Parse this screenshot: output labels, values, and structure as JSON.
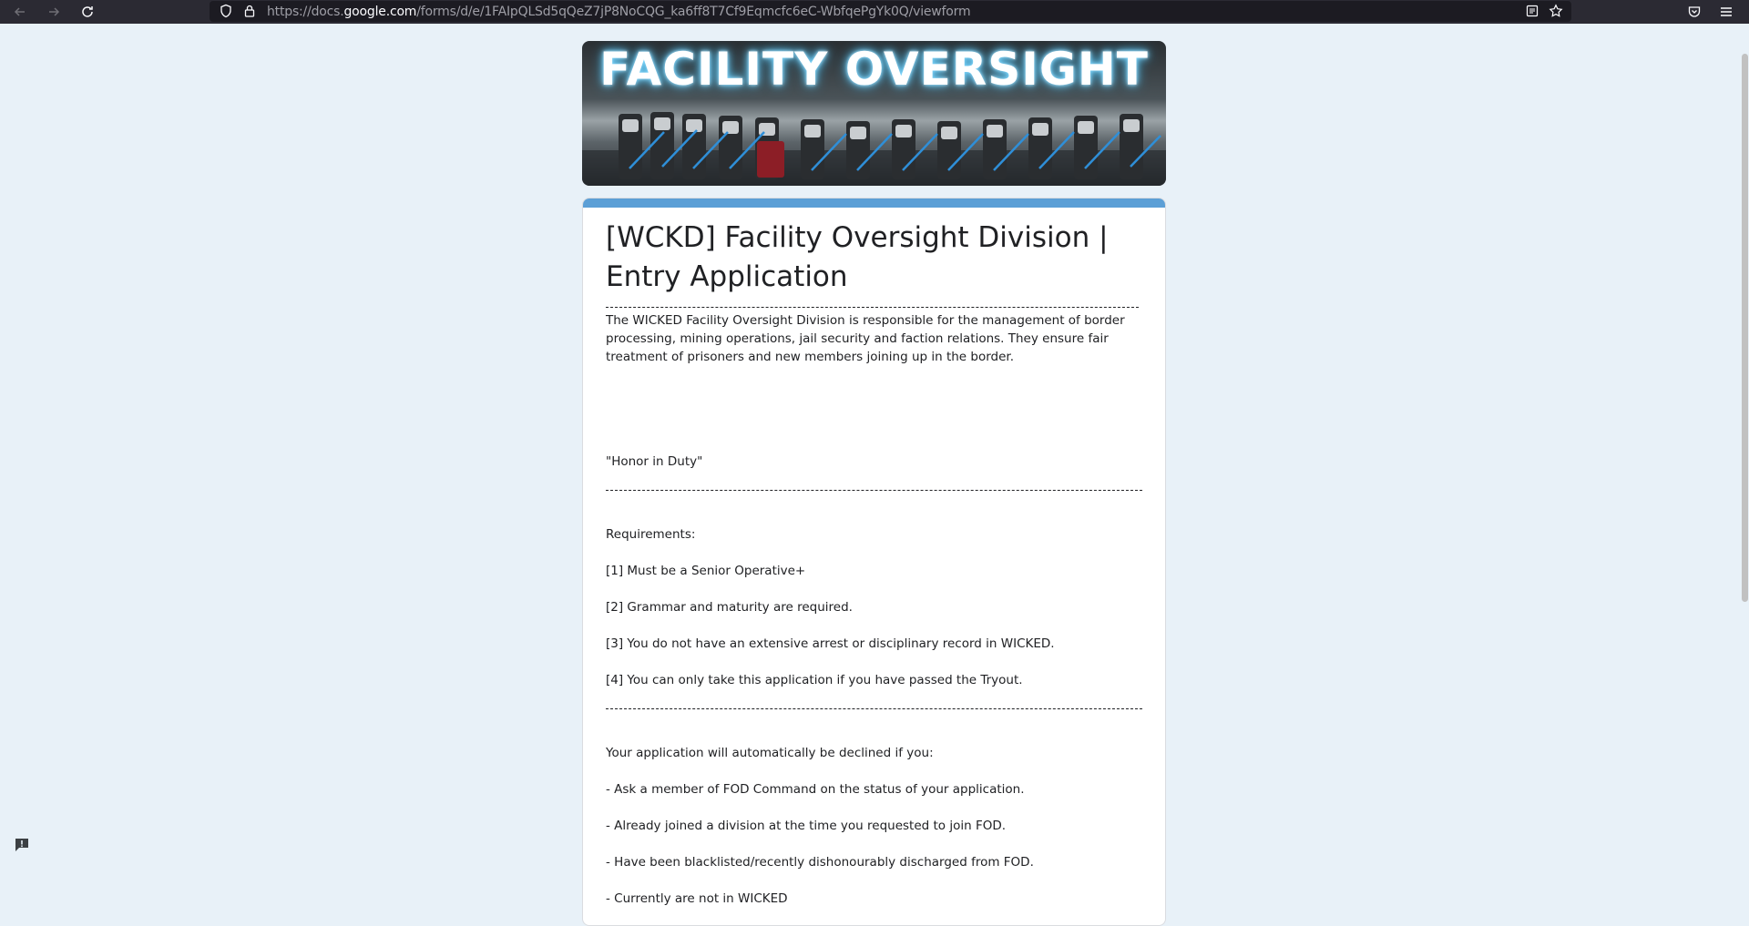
{
  "browser": {
    "url_prefix": "https://docs.",
    "url_host": "google.com",
    "url_path": "/forms/d/e/1FAIpQLSd5qQeZ7jP8NoCQG_ka6ff8T7Cf9Eqmcfc6eC-WbfqePgYk0Q/viewform"
  },
  "banner": {
    "title": "FACILITY OVERSIGHT"
  },
  "form": {
    "title": "[WCKD] Facility Oversight Division | Entry Application",
    "intro": "The WICKED Facility Oversight Division is responsible for the management of border processing, mining operations, jail security and faction relations. They ensure fair treatment of prisoners and new members joining up in the border.",
    "motto": "\"Honor in Duty\"",
    "requirements_heading": "Requirements:",
    "requirements": [
      "[1] Must be a Senior Operative+",
      "[2] Grammar and maturity are required.",
      "[3] You do not have an extensive arrest or disciplinary record in WICKED.",
      "[4] You can only take this application if you have passed the Tryout."
    ],
    "decline_heading": "Your application will automatically be declined if you:",
    "decline_reasons": [
      "- Ask a member of FOD Command on the status of your application.",
      "- Already joined a division at the time you requested to join FOD.",
      "- Have been blacklisted/recently dishonourably discharged from FOD.",
      "- Currently are not in WICKED"
    ]
  },
  "colors": {
    "accent": "#5b9fd6",
    "background": "#e8f1f8"
  }
}
